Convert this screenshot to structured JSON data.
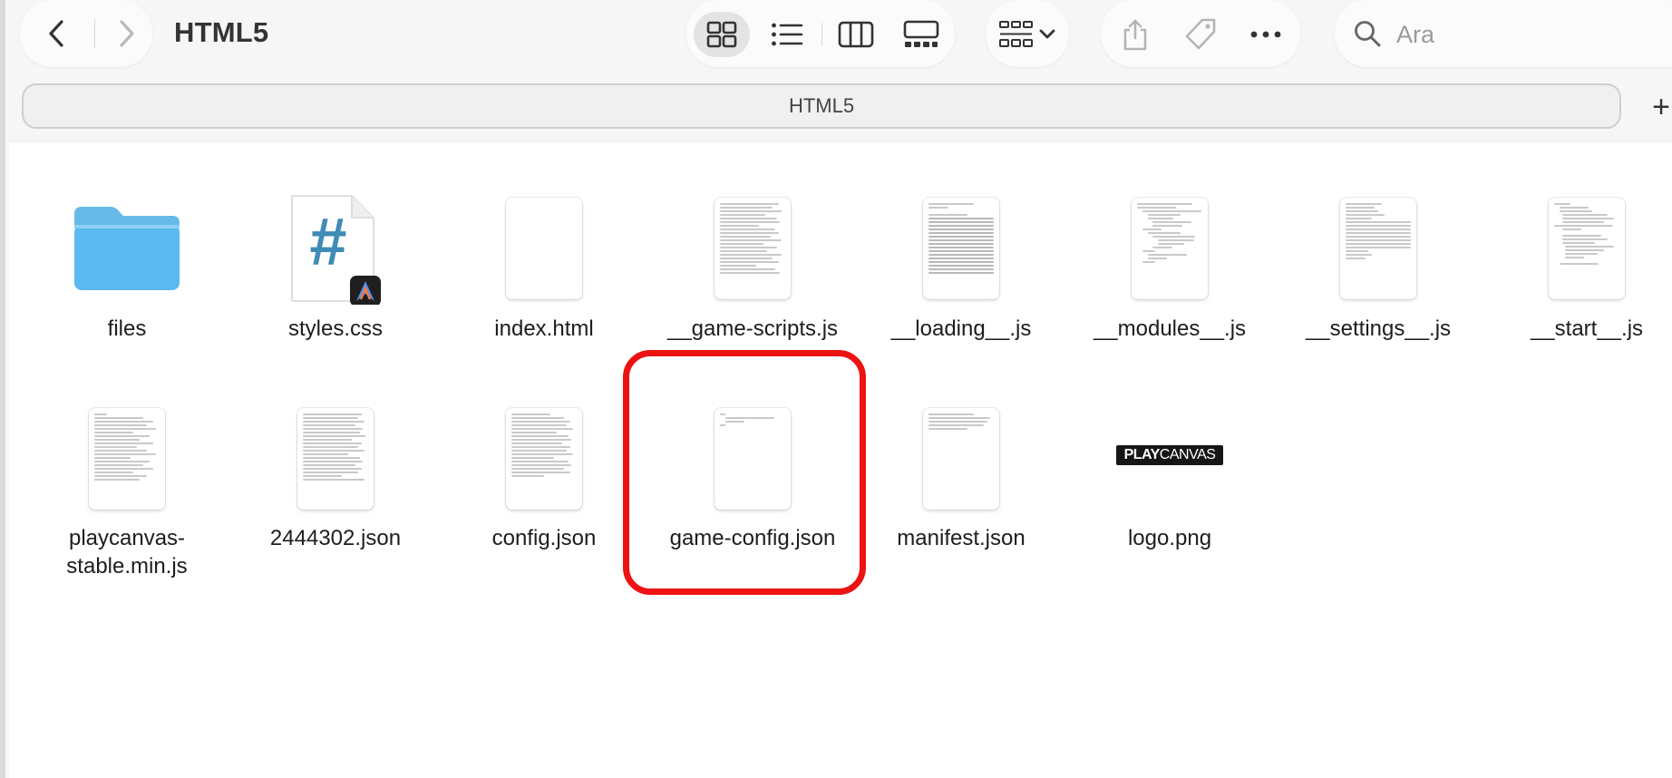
{
  "window": {
    "title": "HTML5"
  },
  "toolbar": {
    "search": {
      "placeholder": "Ara",
      "value": ""
    }
  },
  "path_bar": {
    "tab_label": "HTML5",
    "add_label": "+"
  },
  "files": [
    {
      "name": "files",
      "kind": "folder"
    },
    {
      "name": "styles.css",
      "kind": "css"
    },
    {
      "name": "index.html",
      "kind": "blank-doc"
    },
    {
      "name": "__game-scripts.js",
      "kind": "text-doc"
    },
    {
      "name": "__loading__.js",
      "kind": "text-doc"
    },
    {
      "name": "__modules__.js",
      "kind": "text-doc"
    },
    {
      "name": "__settings__.js",
      "kind": "text-doc"
    },
    {
      "name": "__start__.js",
      "kind": "text-doc"
    },
    {
      "name": "playcanvas-stable.min.js",
      "kind": "text-doc"
    },
    {
      "name": "2444302.json",
      "kind": "text-doc"
    },
    {
      "name": "config.json",
      "kind": "text-doc"
    },
    {
      "name": "game-config.json",
      "kind": "text-doc",
      "highlighted": true
    },
    {
      "name": "manifest.json",
      "kind": "text-doc"
    },
    {
      "name": "logo.png",
      "kind": "image",
      "logo_text_bold": "PLAY",
      "logo_text_light": "CANVAS"
    }
  ],
  "colors": {
    "highlight": "#ec1313",
    "folder": "#4fb6ea",
    "css_hash": "#3f8bb5"
  }
}
